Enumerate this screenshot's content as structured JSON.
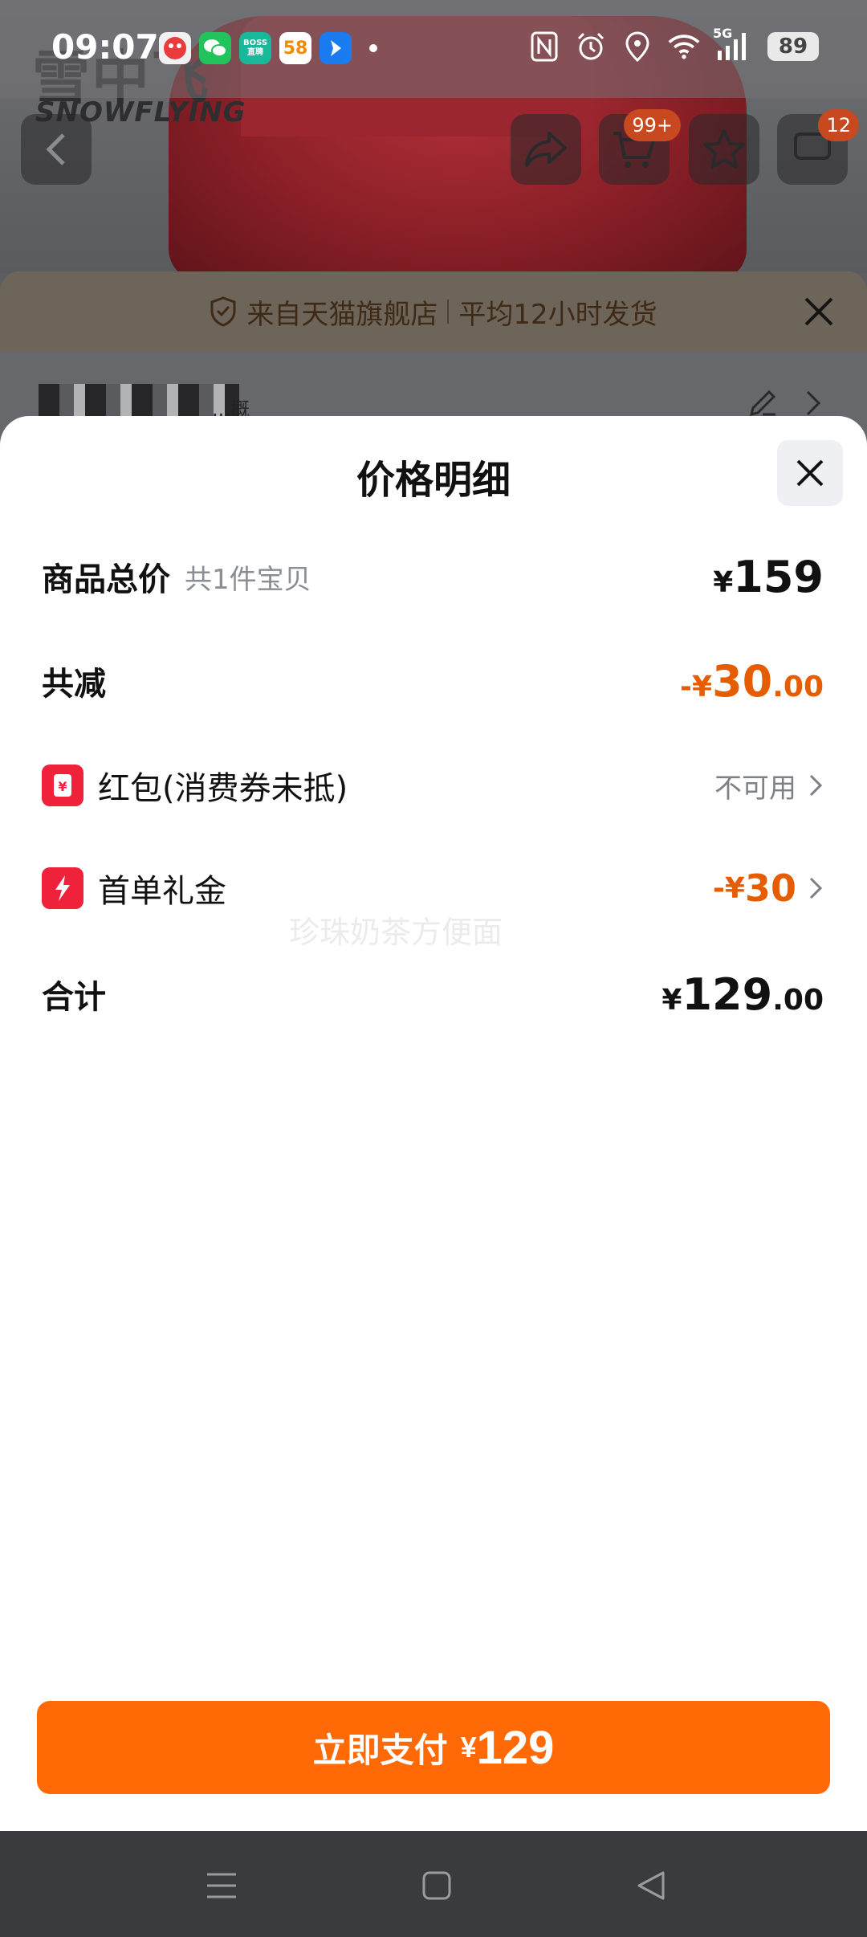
{
  "status_bar": {
    "time": "09:07",
    "battery": "89",
    "network": "5G",
    "app_icons": [
      "xiaohongshu-app-icon",
      "wechat-app-icon",
      "boss-zhipin-app-icon",
      "58-app-icon",
      "maps-app-icon"
    ],
    "boss_label_top": "BOSS",
    "boss_label_bottom": "直聘",
    "app58_label": "58"
  },
  "product_page": {
    "brand_logo_text": "雪中飞",
    "brand_sub_text": "SNOWFLYING",
    "cart_badge": "99+",
    "message_badge": "12",
    "store_banner": {
      "source": "来自天猫旗舰店",
      "shipping": "平均12小时发货"
    },
    "address_suffix": "...概"
  },
  "sheet": {
    "title": "价格明细",
    "rows": {
      "subtotal": {
        "label": "商品总价",
        "sub": "共1件宝贝",
        "currency": "¥",
        "amount": "159"
      },
      "discount": {
        "label": "共减",
        "sign": "-",
        "currency": "¥",
        "amount": "30",
        "decimals": ".00"
      },
      "red_packet": {
        "label": "红包(消费券未抵)",
        "status": "不可用"
      },
      "first_order": {
        "label": "首单礼金",
        "sign": "-",
        "currency": "¥",
        "amount": "30"
      },
      "total": {
        "label": "合计",
        "currency": "¥",
        "amount": "129",
        "decimals": ".00"
      }
    },
    "watermark": "珍珠奶茶方便面",
    "pay_button": {
      "label": "立即支付",
      "currency": "¥",
      "amount": "129"
    }
  },
  "colors": {
    "accent_orange": "#ff6a07",
    "discount_orange": "#e65c00",
    "coupon_red": "#f0213b"
  }
}
